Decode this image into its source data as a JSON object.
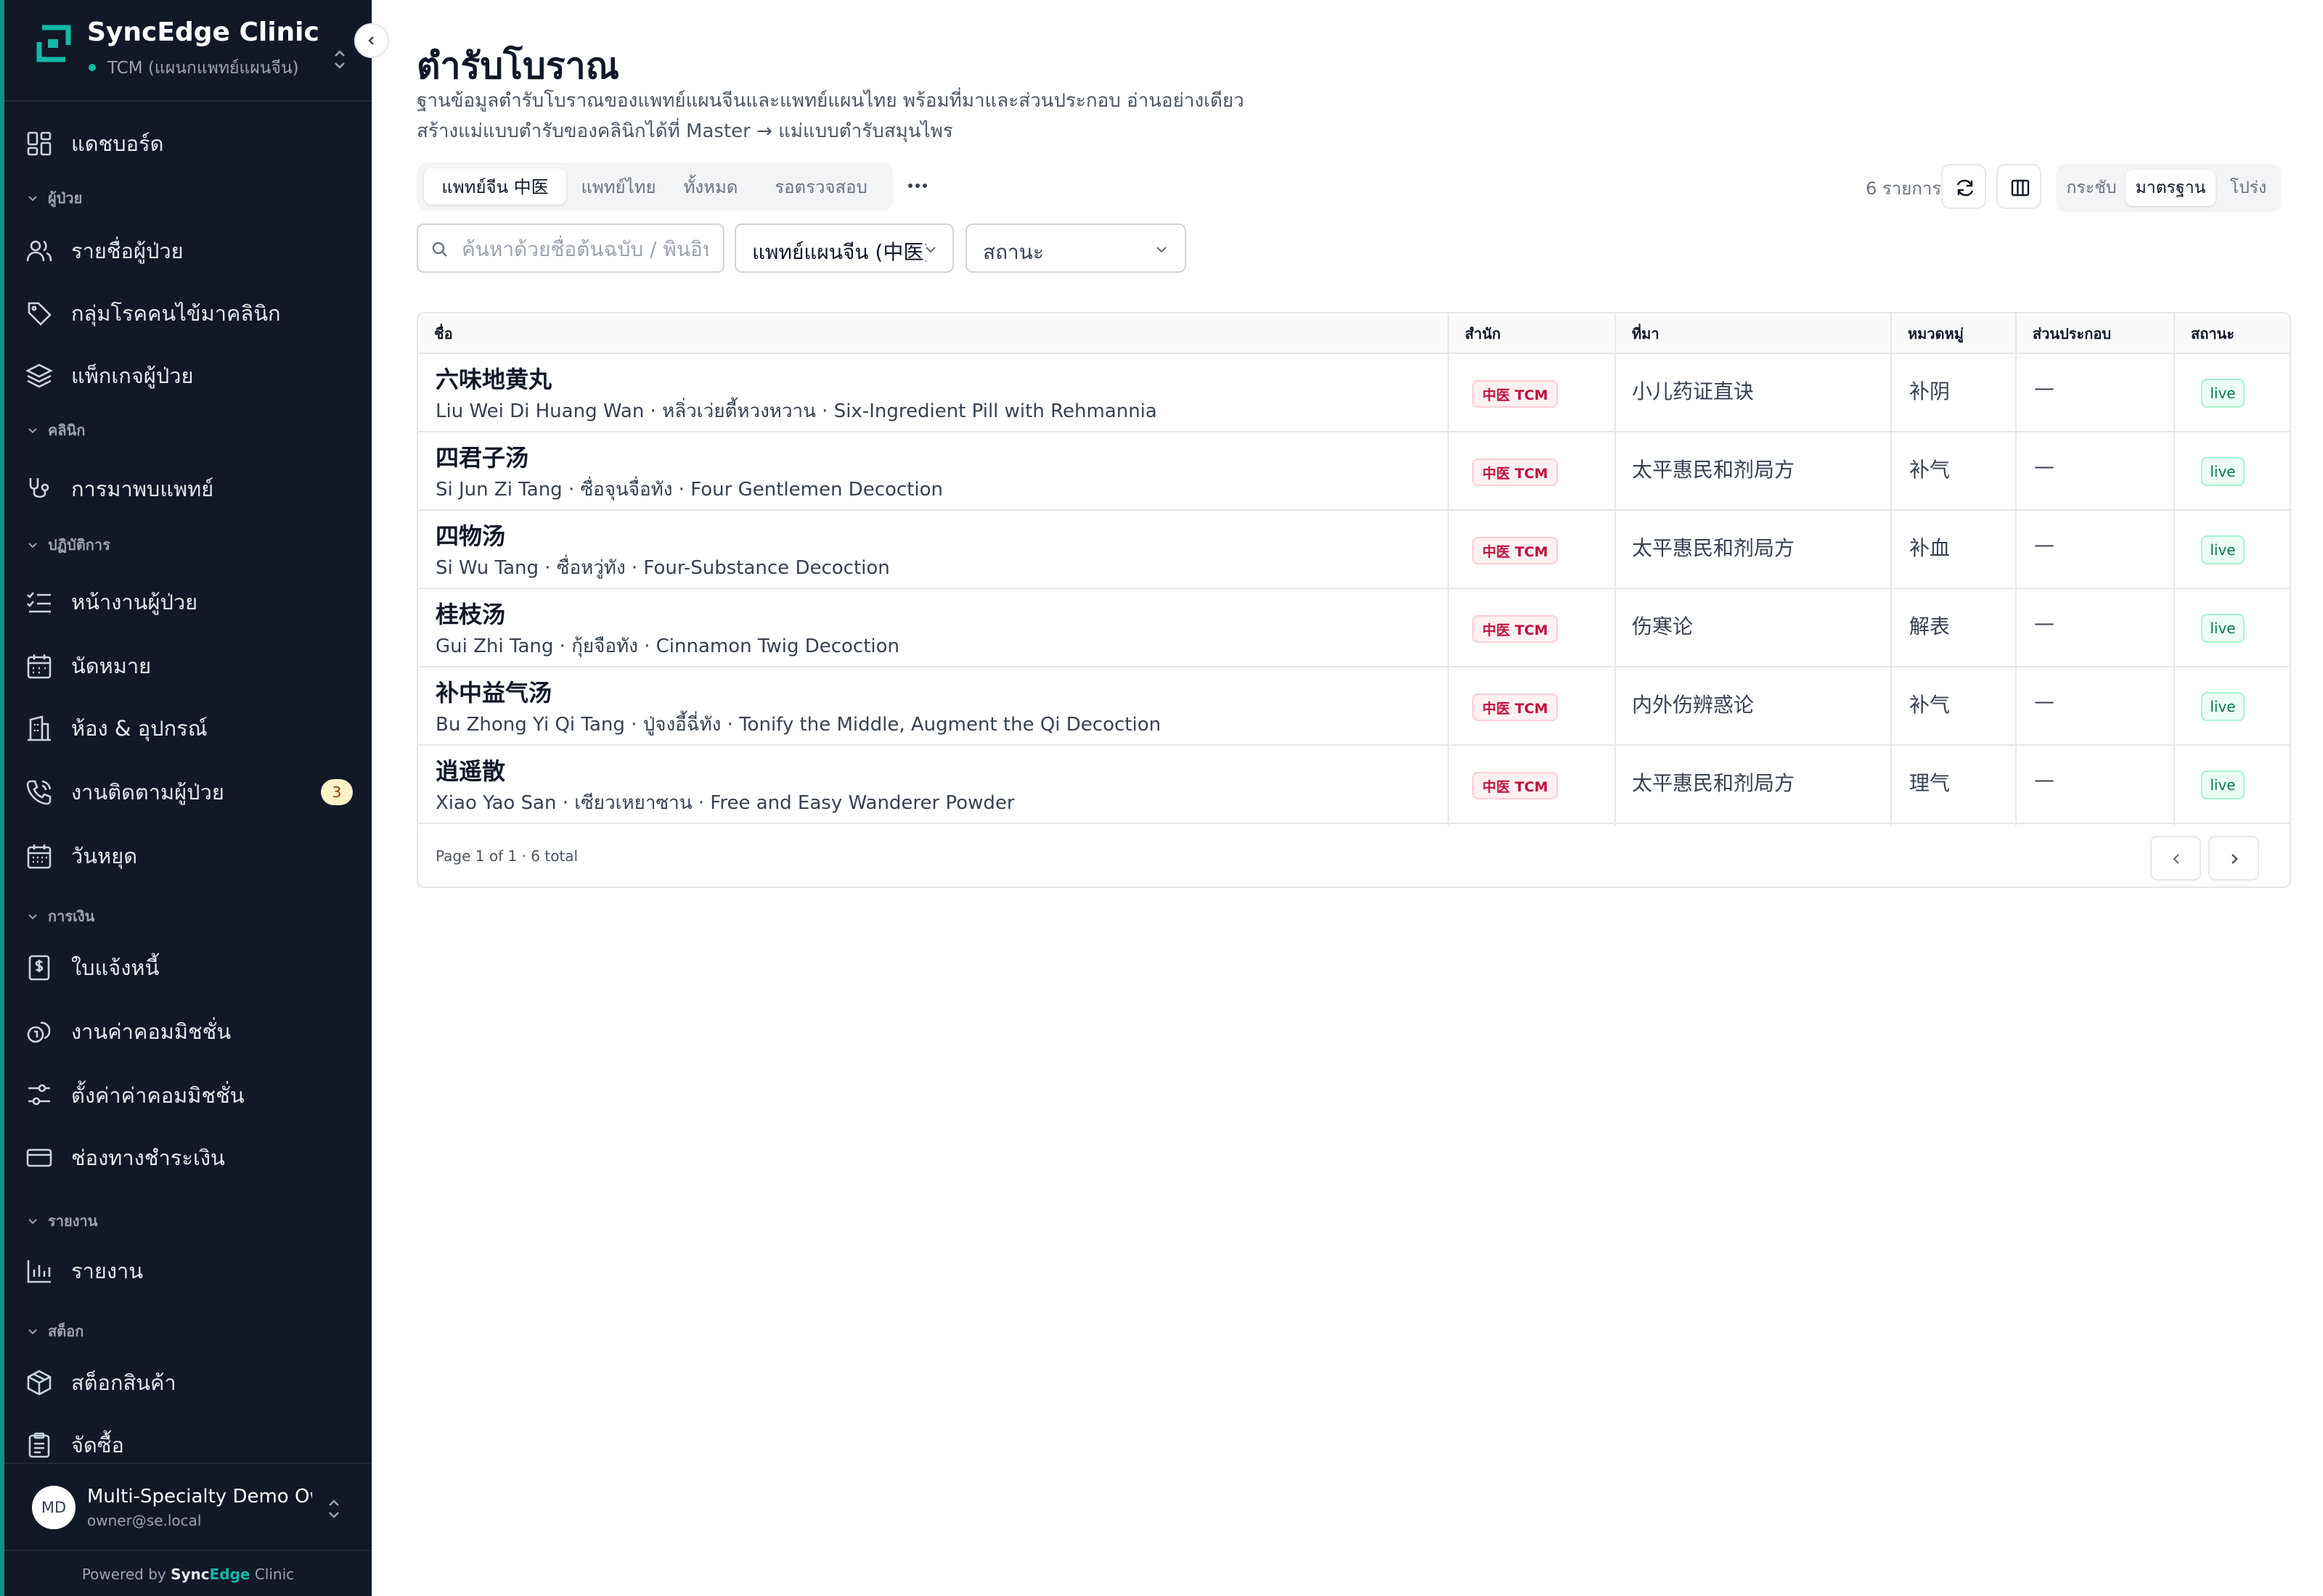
{
  "brand": {
    "name": "SyncEdge Clinic",
    "branch": "TCM (แผนกแพทย์แผนจีน)"
  },
  "sidebar": {
    "items": [
      {
        "label": "แดชบอร์ด",
        "icon": "dashboard-icon"
      },
      {
        "label": "รายชื่อผู้ป่วย",
        "icon": "users-icon"
      },
      {
        "label": "กลุ่มโรคคนไข้มาคลินิก",
        "icon": "tag-icon"
      },
      {
        "label": "แพ็กเกจผู้ป่วย",
        "icon": "layers-icon"
      },
      {
        "label": "การมาพบแพทย์",
        "icon": "stethoscope-icon"
      },
      {
        "label": "หน้างานผู้ป่วย",
        "icon": "checklist-icon"
      },
      {
        "label": "นัดหมาย",
        "icon": "calendar-icon"
      },
      {
        "label": "ห้อง & อุปกรณ์",
        "icon": "building-icon"
      },
      {
        "label": "งานติดตามผู้ป่วย",
        "icon": "phone-icon",
        "badge": "3"
      },
      {
        "label": "วันหยุด",
        "icon": "calendar-grid-icon"
      },
      {
        "label": "ใบแจ้งหนี้",
        "icon": "invoice-icon"
      },
      {
        "label": "งานค่าคอมมิชชั่น",
        "icon": "coins-icon"
      },
      {
        "label": "ตั้งค่าค่าคอมมิชชั่น",
        "icon": "sliders-icon"
      },
      {
        "label": "ช่องทางชำระเงิน",
        "icon": "credit-card-icon"
      },
      {
        "label": "รายงาน",
        "icon": "bar-chart-icon"
      },
      {
        "label": "สต็อกสินค้า",
        "icon": "package-icon"
      },
      {
        "label": "จัดซื้อ",
        "icon": "clipboard-icon"
      }
    ],
    "sections": {
      "patients": "ผู้ป่วย",
      "clinic": "คลินิก",
      "operations": "ปฏิบัติการ",
      "finance": "การเงิน",
      "reports": "รายงาน",
      "stock": "สต็อก"
    }
  },
  "user": {
    "initials": "MD",
    "name": "Multi-Specialty Demo Owner",
    "email": "owner@se.local"
  },
  "footer": {
    "powered_prefix": "Powered by ",
    "powered_brand_a": "Sync",
    "powered_brand_b": "Edge",
    "powered_suffix": " Clinic"
  },
  "page": {
    "title": "ตำรับโบราณ",
    "description": "ฐานข้อมูลตำรับโบราณของแพทย์แผนจีนและแพทย์แผนไทย พร้อมที่มาและส่วนประกอบ อ่านอย่างเดียว สร้างแม่แบบตำรับของคลินิกได้ที่ Master → แม่แบบตำรับสมุนไพร"
  },
  "tabs": [
    {
      "label": "แพทย์จีน 中医",
      "active": true
    },
    {
      "label": "แพทย์ไทย",
      "active": false
    },
    {
      "label": "ทั้งหมด",
      "active": false
    },
    {
      "label": "รอตรวจสอบ",
      "active": false
    }
  ],
  "toolbar": {
    "row_count": "6 รายการ",
    "density": [
      "กระชับ",
      "มาตรฐาน",
      "โปร่ง"
    ],
    "density_selected": "มาตรฐาน"
  },
  "filters": {
    "search_placeholder": "ค้นหาด้วยชื่อต้นฉบับ / พินอิน",
    "tradition_value": "แพทย์แผนจีน (中医)",
    "status_placeholder": "สถานะ"
  },
  "table": {
    "columns": [
      "ชื่อ",
      "สำนัก",
      "ที่มา",
      "หมวดหมู่",
      "ส่วนประกอบ",
      "สถานะ"
    ],
    "rows": [
      {
        "name": "六味地黄丸",
        "sub": "Liu Wei Di Huang Wan · หลิ่วเว่ยตี้หวงหวาน · Six-Ingredient Pill with Rehmannia",
        "school": "中医 TCM",
        "source": "小儿药证直诀",
        "category": "补阴",
        "ingredients": "—",
        "status": "live"
      },
      {
        "name": "四君子汤",
        "sub": "Si Jun Zi Tang · ซื่อจุนจื่อทัง · Four Gentlemen Decoction",
        "school": "中医 TCM",
        "source": "太平惠民和剂局方",
        "category": "补气",
        "ingredients": "—",
        "status": "live"
      },
      {
        "name": "四物汤",
        "sub": "Si Wu Tang · ซื่อหวู่ทัง · Four-Substance Decoction",
        "school": "中医 TCM",
        "source": "太平惠民和剂局方",
        "category": "补血",
        "ingredients": "—",
        "status": "live"
      },
      {
        "name": "桂枝汤",
        "sub": "Gui Zhi Tang · กุ้ยจือทัง · Cinnamon Twig Decoction",
        "school": "中医 TCM",
        "source": "伤寒论",
        "category": "解表",
        "ingredients": "—",
        "status": "live"
      },
      {
        "name": "补中益气汤",
        "sub": "Bu Zhong Yi Qi Tang · ปู่จงอี้ฉี่ทัง · Tonify the Middle, Augment the Qi Decoction",
        "school": "中医 TCM",
        "source": "内外伤辨惑论",
        "category": "补气",
        "ingredients": "—",
        "status": "live"
      },
      {
        "name": "逍遥散",
        "sub": "Xiao Yao San · เซียวเหยาซาน · Free and Easy Wanderer Powder",
        "school": "中医 TCM",
        "source": "太平惠民和剂局方",
        "category": "理气",
        "ingredients": "—",
        "status": "live"
      }
    ],
    "pagination": "Page 1 of 1 · 6 total"
  },
  "colors": {
    "sidebar_bg": "#111827",
    "accent": "#0d9488",
    "tcm_chip": "#be123c",
    "live_chip": "#047857"
  }
}
